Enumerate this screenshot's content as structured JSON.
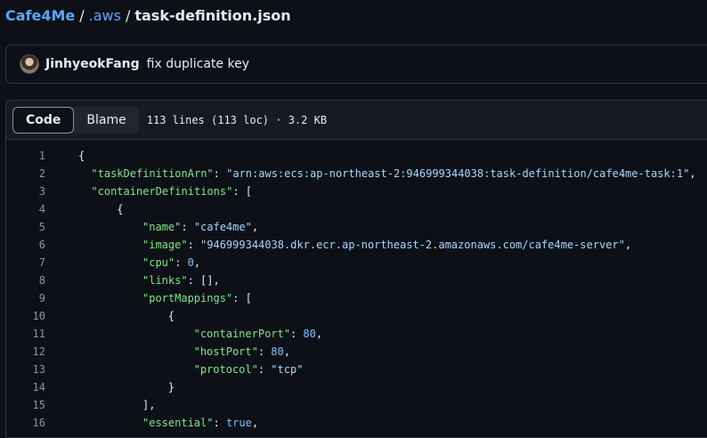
{
  "breadcrumb": {
    "repo": "Cafe4Me",
    "separator": "/",
    "dir": ".aws",
    "file": "task-definition.json"
  },
  "commit": {
    "author": "JinhyeokFang",
    "message": "fix duplicate key"
  },
  "file_header": {
    "tabs": [
      {
        "label": "Code",
        "active": true
      },
      {
        "label": "Blame",
        "active": false
      }
    ],
    "meta": "113 lines (113 loc) · 3.2 KB"
  },
  "code": {
    "lines": [
      {
        "n": "1",
        "indent": 0,
        "tokens": [
          {
            "t": "p",
            "v": "{"
          }
        ]
      },
      {
        "n": "2",
        "indent": 2,
        "tokens": [
          {
            "t": "k",
            "v": "\"taskDefinitionArn\""
          },
          {
            "t": "p",
            "v": ": "
          },
          {
            "t": "s",
            "v": "\"arn:aws:ecs:ap-northeast-2:946999344038:task-definition/cafe4me-task:1\""
          },
          {
            "t": "p",
            "v": ","
          }
        ]
      },
      {
        "n": "3",
        "indent": 2,
        "tokens": [
          {
            "t": "k",
            "v": "\"containerDefinitions\""
          },
          {
            "t": "p",
            "v": ": ["
          }
        ]
      },
      {
        "n": "4",
        "indent": 6,
        "tokens": [
          {
            "t": "p",
            "v": "{"
          }
        ]
      },
      {
        "n": "5",
        "indent": 10,
        "tokens": [
          {
            "t": "k",
            "v": "\"name\""
          },
          {
            "t": "p",
            "v": ": "
          },
          {
            "t": "s",
            "v": "\"cafe4me\""
          },
          {
            "t": "p",
            "v": ","
          }
        ]
      },
      {
        "n": "6",
        "indent": 10,
        "tokens": [
          {
            "t": "k",
            "v": "\"image\""
          },
          {
            "t": "p",
            "v": ": "
          },
          {
            "t": "s",
            "v": "\"946999344038.dkr.ecr.ap-northeast-2.amazonaws.com/cafe4me-server\""
          },
          {
            "t": "p",
            "v": ","
          }
        ]
      },
      {
        "n": "7",
        "indent": 10,
        "tokens": [
          {
            "t": "k",
            "v": "\"cpu\""
          },
          {
            "t": "p",
            "v": ": "
          },
          {
            "t": "n",
            "v": "0"
          },
          {
            "t": "p",
            "v": ","
          }
        ]
      },
      {
        "n": "8",
        "indent": 10,
        "tokens": [
          {
            "t": "k",
            "v": "\"links\""
          },
          {
            "t": "p",
            "v": ": [],"
          }
        ]
      },
      {
        "n": "9",
        "indent": 10,
        "tokens": [
          {
            "t": "k",
            "v": "\"portMappings\""
          },
          {
            "t": "p",
            "v": ": ["
          }
        ]
      },
      {
        "n": "10",
        "indent": 14,
        "tokens": [
          {
            "t": "p",
            "v": "{"
          }
        ]
      },
      {
        "n": "11",
        "indent": 18,
        "tokens": [
          {
            "t": "k",
            "v": "\"containerPort\""
          },
          {
            "t": "p",
            "v": ": "
          },
          {
            "t": "n",
            "v": "80"
          },
          {
            "t": "p",
            "v": ","
          }
        ]
      },
      {
        "n": "12",
        "indent": 18,
        "tokens": [
          {
            "t": "k",
            "v": "\"hostPort\""
          },
          {
            "t": "p",
            "v": ": "
          },
          {
            "t": "n",
            "v": "80"
          },
          {
            "t": "p",
            "v": ","
          }
        ]
      },
      {
        "n": "13",
        "indent": 18,
        "tokens": [
          {
            "t": "k",
            "v": "\"protocol\""
          },
          {
            "t": "p",
            "v": ": "
          },
          {
            "t": "s",
            "v": "\"tcp\""
          }
        ]
      },
      {
        "n": "14",
        "indent": 14,
        "tokens": [
          {
            "t": "p",
            "v": "}"
          }
        ]
      },
      {
        "n": "15",
        "indent": 10,
        "tokens": [
          {
            "t": "p",
            "v": "],"
          }
        ]
      },
      {
        "n": "16",
        "indent": 10,
        "tokens": [
          {
            "t": "k",
            "v": "\"essential\""
          },
          {
            "t": "p",
            "v": ": "
          },
          {
            "t": "n",
            "v": "true"
          },
          {
            "t": "p",
            "v": ","
          }
        ]
      }
    ]
  }
}
